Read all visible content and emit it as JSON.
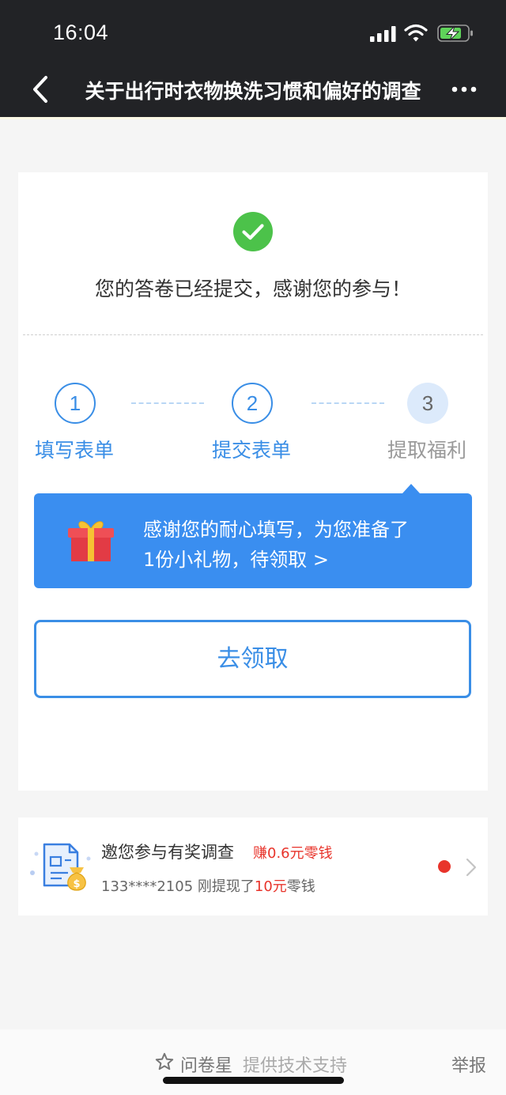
{
  "status_bar": {
    "time": "16:04"
  },
  "nav": {
    "title": "关于出行时衣物换洗习惯和偏好的调查"
  },
  "result": {
    "message": "您的答卷已经提交，感谢您的参与！"
  },
  "steps": [
    {
      "number": "1",
      "label": "填写表单",
      "state": "done"
    },
    {
      "number": "2",
      "label": "提交表单",
      "state": "done"
    },
    {
      "number": "3",
      "label": "提取福利",
      "state": "current"
    }
  ],
  "gift_banner": {
    "line1": "感谢您的耐心填写，为您准备了",
    "line2": "1份小礼物，待领取 >"
  },
  "claim_button": {
    "label": "去领取"
  },
  "promo": {
    "title": "邀您参与有奖调查",
    "earn": "赚0.6元零钱",
    "sub_prefix": "133****2105 刚提现了",
    "sub_amount": "10元",
    "sub_suffix": "零钱"
  },
  "footer": {
    "brand": "问卷星",
    "tech_support": "提供技术支持",
    "report": "举报"
  },
  "colors": {
    "accent": "#3a8ee6",
    "banner": "#3a8ef0",
    "success": "#4cc24a",
    "highlight": "#e8342b"
  },
  "icons": [
    "signal-icon",
    "wifi-icon",
    "battery-charging-icon",
    "back-icon",
    "more-icon",
    "check-icon",
    "gift-icon",
    "survey-money-icon",
    "chevron-right-icon",
    "star-icon"
  ]
}
